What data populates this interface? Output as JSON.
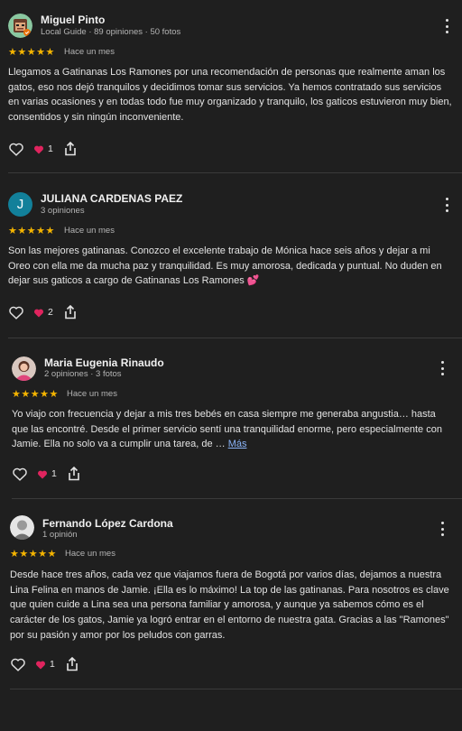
{
  "reviews": [
    {
      "author": "Miguel Pinto",
      "meta": "Local Guide · 89 opiniones · 50 fotos",
      "stars": "★★★★★",
      "time": "Hace un mes",
      "text": "Llegamos a Gatinanas Los Ramones por una recomendación de personas que realmente aman los gatos, eso nos dejó tranquilos y decidimos tomar sus servicios. Ya hemos contratado sus servicios en varias ocasiones y en todas todo fue muy organizado y tranquilo, los gaticos estuvieron muy bien, consentidos y sin ningún inconveniente.",
      "heart_count": "1"
    },
    {
      "author": "JULIANA CARDENAS PAEZ",
      "avatar_letter": "J",
      "meta": "3 opiniones",
      "stars": "★★★★★",
      "time": "Hace un mes",
      "text": "Son las mejores gatinanas. Conozco el excelente trabajo de Mónica hace seis años y dejar a mi Oreo con ella me da mucha paz y tranquilidad. Es muy amorosa, dedicada y puntual. No duden en dejar sus gaticos a cargo de Gatinanas Los Ramones 💕",
      "heart_count": "2"
    },
    {
      "author": "Maria Eugenia Rinaudo",
      "meta": "2 opiniones · 3 fotos",
      "stars": "★★★★★",
      "time": "Hace un mes",
      "text": "Yo viajo con frecuencia y dejar a mis tres bebés en casa siempre me generaba angustia… hasta que las encontré. Desde el primer servicio sentí una tranquilidad enorme, pero especialmente con Jamie. Ella no solo va a cumplir una tarea, de …",
      "more": "Más",
      "heart_count": "1"
    },
    {
      "author": "Fernando López Cardona",
      "meta": "1 opinión",
      "stars": "★★★★★",
      "time": "Hace un mes",
      "text": "Desde hace tres años, cada vez que viajamos fuera de Bogotá por varios días, dejamos a nuestra Lina Felina en manos de Jamie. ¡Ella es lo máximo! La top de las gatinanas. Para nosotros es clave que quien cuide a Lina sea una persona familiar y amorosa, y aunque ya sabemos cómo es el carácter de los gatos, Jamie ya logró entrar en el entorno de nuestra gata. Gracias a las \"Ramones\" por su pasión y amor por los peludos con garras.",
      "heart_count": "1"
    }
  ],
  "colors": {
    "star": "#f4b400",
    "heart": "#e0245e",
    "link": "#8ab4f8",
    "avatar_j": "#12809a"
  },
  "icons": {
    "like": "heart-outline-icon",
    "reaction": "heart-red-icon",
    "share": "share-icon",
    "menu": "more-vert-icon"
  }
}
